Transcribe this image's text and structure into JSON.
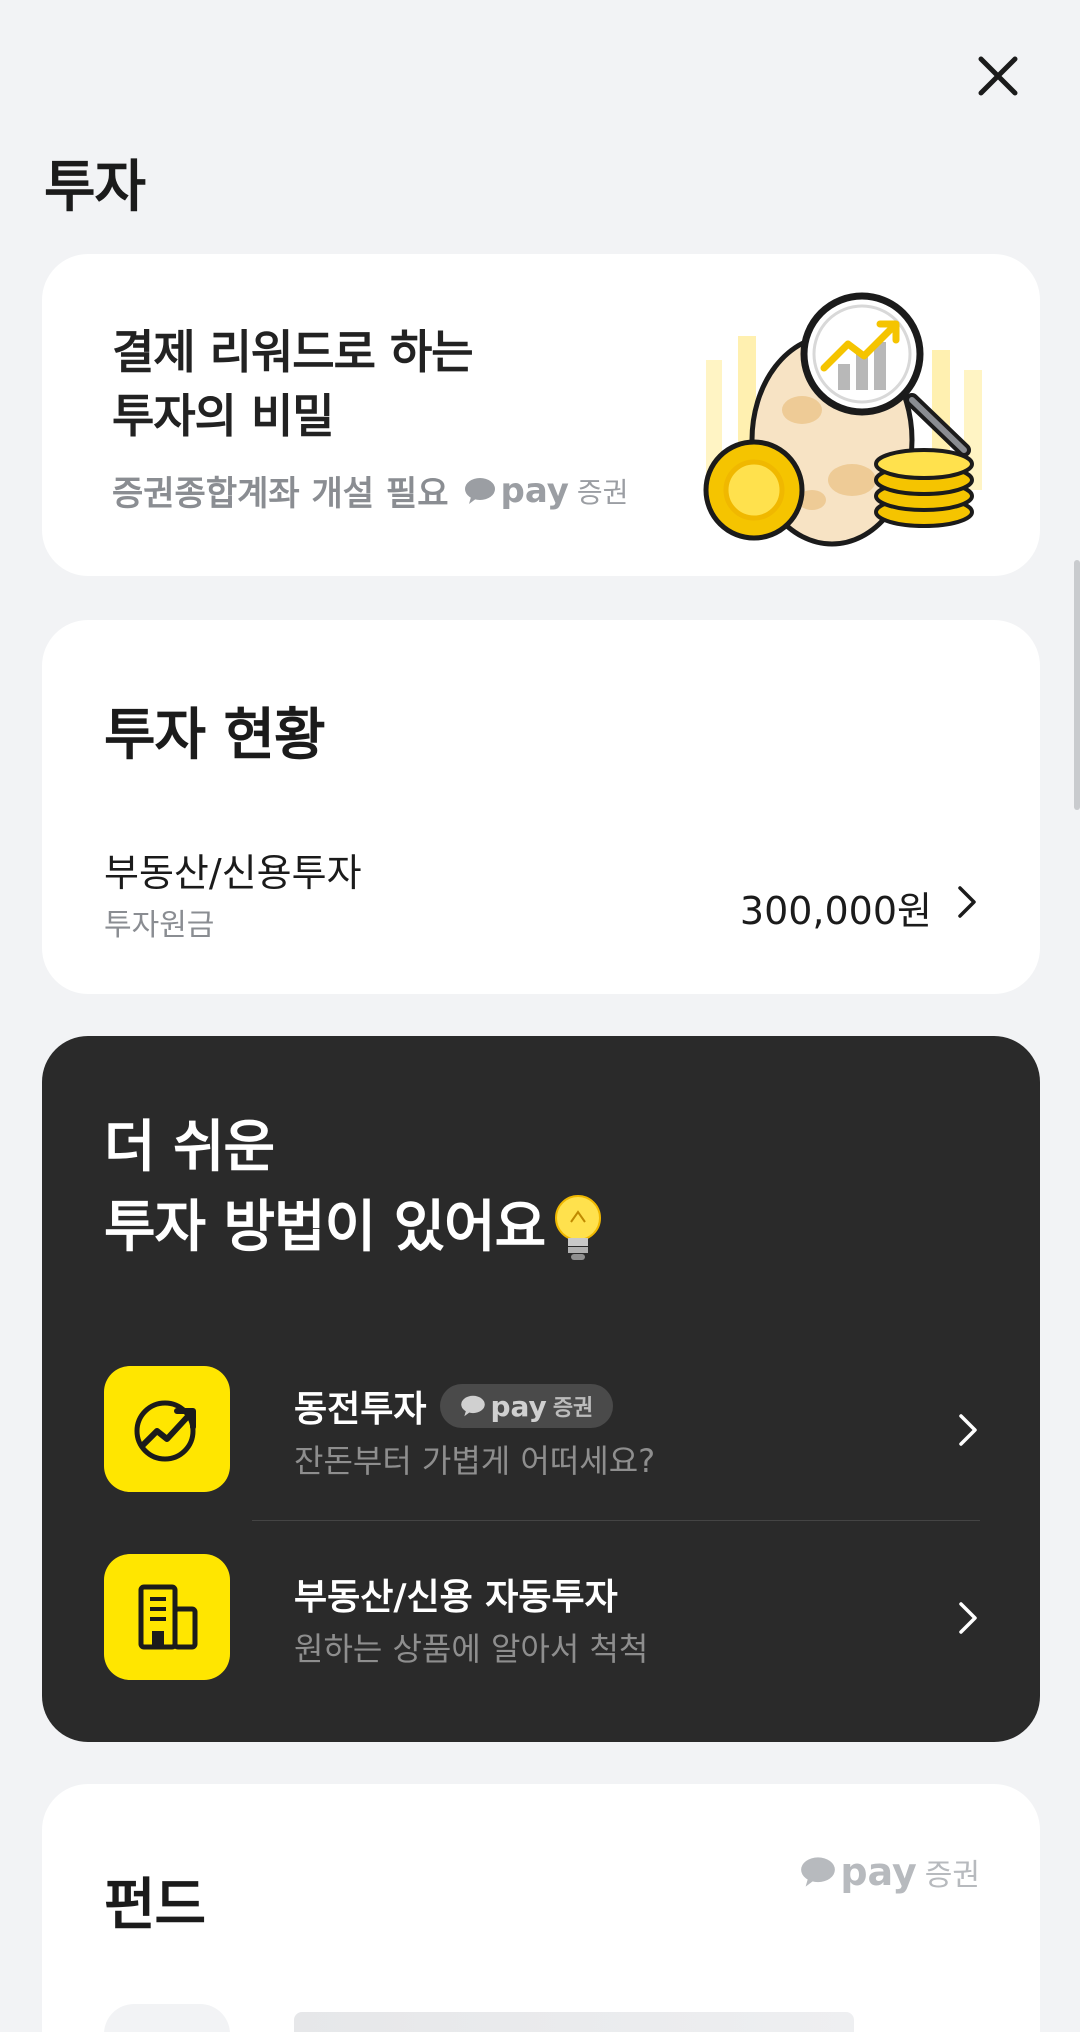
{
  "header": {
    "title": "투자"
  },
  "promo": {
    "title_line1": "결제 리워드로 하는",
    "title_line2": "투자의 비밀",
    "subtitle": "증권종합계좌 개설 필요",
    "brand_pay": "pay",
    "brand_sec": "증권"
  },
  "status": {
    "title": "투자 현황",
    "item": {
      "name": "부동산/신용투자",
      "caption": "투자원금",
      "amount": "300,000원"
    }
  },
  "easy": {
    "title_line1": "더 쉬운",
    "title_line2": "투자 방법이 있어요",
    "items": [
      {
        "title": "동전투자",
        "badge_pay": "pay",
        "badge_sec": "증권",
        "subtitle": "잔돈부터 가볍게 어떠세요?",
        "icon": "coin-growth-icon"
      },
      {
        "title": "부동산/신용 자동투자",
        "subtitle": "원하는 상품에 알아서 척척",
        "icon": "building-icon"
      }
    ]
  },
  "fund": {
    "title": "펀드",
    "brand_pay": "pay",
    "brand_sec": "증권"
  },
  "colors": {
    "accent_yellow": "#ffe600",
    "dark_card": "#2a2a2a",
    "background": "#f2f3f5"
  }
}
